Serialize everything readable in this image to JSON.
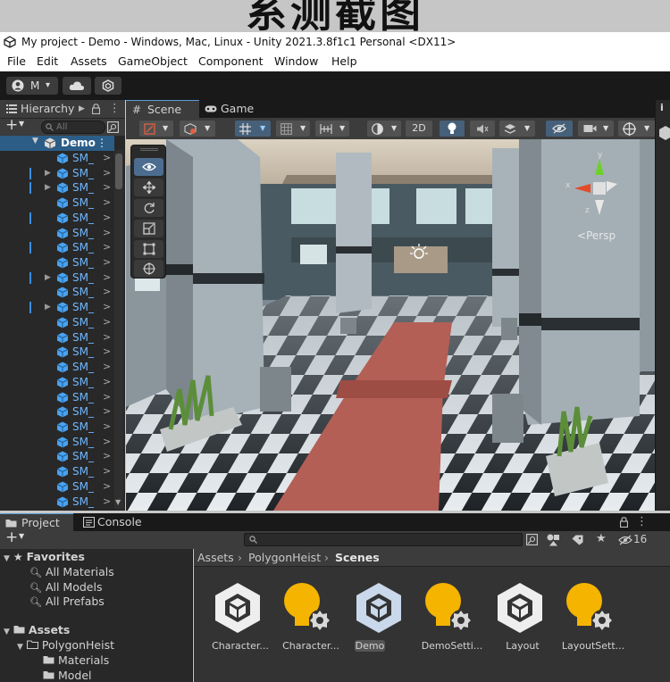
{
  "banner": {
    "text": "系测截图"
  },
  "window": {
    "title": "My project - Demo - Windows, Mac, Linux - Unity 2021.3.8f1c1 Personal <DX11>"
  },
  "menu": [
    "File",
    "Edit",
    "Assets",
    "GameObject",
    "Component",
    "Window",
    "Help"
  ],
  "toolbar": {
    "account_label": "M",
    "account_caret": "▾"
  },
  "hierarchy": {
    "tab_label": "Hierarchy",
    "add_label": "+",
    "search_placeholder": "All",
    "root_label": "Demo",
    "root_more": "⋮",
    "items": [
      "SM_",
      "SM_",
      "SM_",
      "SM_",
      "SM_",
      "SM_",
      "SM_",
      "SM_",
      "SM_",
      "SM_",
      "SM_",
      "SM_",
      "SM_",
      "SM_",
      "SM_",
      "SM_",
      "SM_",
      "SM_",
      "SM_",
      "SM_",
      "SM_",
      "SM_",
      "SM_",
      "SM_"
    ],
    "expandable_rows": [
      1,
      2,
      8,
      10
    ],
    "marked_rows": [
      1,
      2,
      4,
      6,
      8,
      10
    ],
    "item_arrow": ">"
  },
  "scene": {
    "tabs": [
      "Scene",
      "Game"
    ],
    "mode_2d": "2D",
    "persp_label": "Persp",
    "gizmo_axis_y": "y",
    "gizmo_axis_x": "x",
    "gizmo_axis_z": "z"
  },
  "bottom": {
    "tabs": [
      "Project",
      "Console"
    ],
    "add_label": "+",
    "hidden_count": "16",
    "favorites": {
      "label": "Favorites",
      "items": [
        "All Materials",
        "All Models",
        "All Prefabs"
      ]
    },
    "assets_tree": {
      "root": "Assets",
      "child": "PolygonHeist",
      "grandchildren": [
        "Materials",
        "Model"
      ]
    },
    "breadcrumb": [
      "Assets",
      "PolygonHeist",
      "Scenes"
    ],
    "assets": [
      {
        "label": "Character...",
        "kind": "unity-scene"
      },
      {
        "label": "Character...",
        "kind": "lighting"
      },
      {
        "label": "Demo",
        "kind": "unity-scene-selected"
      },
      {
        "label": "DemoSetti...",
        "kind": "lighting"
      },
      {
        "label": "Layout",
        "kind": "unity-scene"
      },
      {
        "label": "LayoutSett...",
        "kind": "lighting"
      }
    ]
  },
  "colors": {
    "accent": "#3a8de0",
    "panel": "#282828",
    "header": "#3c3c3c",
    "lighting_bulb": "#f5b400"
  }
}
